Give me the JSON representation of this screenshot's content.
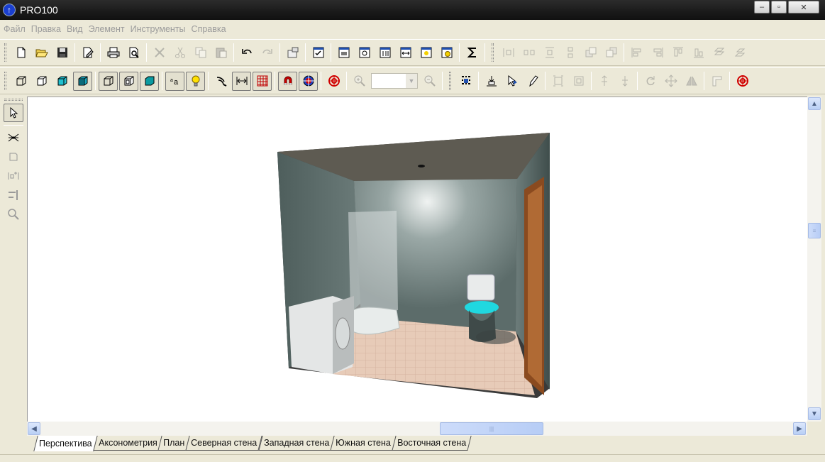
{
  "window": {
    "title": "PRO100",
    "controls": {
      "minimize": "‒",
      "maximize": "▫",
      "close": "✕"
    }
  },
  "menu": [
    "Файл",
    "Правка",
    "Вид",
    "Элемент",
    "Инструменты",
    "Справка"
  ],
  "zoom": {
    "value": ""
  },
  "tabs": [
    {
      "label": "Перспектива",
      "active": true
    },
    {
      "label": "Аксонометрия",
      "active": false
    },
    {
      "label": "План",
      "active": false
    },
    {
      "label": "Северная стена",
      "active": false
    },
    {
      "label": "Западная стена",
      "active": false
    },
    {
      "label": "Южная стена",
      "active": false
    },
    {
      "label": "Восточная стена",
      "active": false
    }
  ],
  "scene": {
    "description_icons": [
      "washing-machine",
      "bathtub",
      "toilet",
      "door",
      "ceiling-light"
    ],
    "colors": {
      "wall": "#5f706e",
      "ceiling": "#5e5b52",
      "floor": "#e6cbb7",
      "door": "#8a4a1f",
      "toilet_seat": "#20d8e0"
    }
  }
}
